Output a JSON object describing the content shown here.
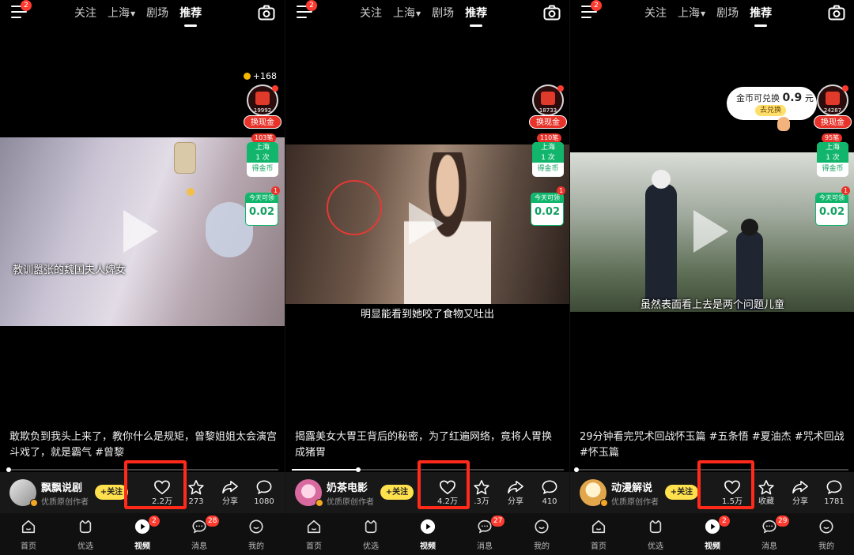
{
  "panels": [
    {
      "nav": {
        "menu_badge": "2",
        "tabs": [
          "关注",
          "上海",
          "剧场",
          "推荐"
        ],
        "active_tab": "推荐"
      },
      "coins": {
        "plus": "+168",
        "redpack_count": "19992",
        "cash_label": "换现金"
      },
      "task": {
        "badge": "103笔",
        "line1": "上海",
        "line2": "1 次",
        "line3": "得金币"
      },
      "daily": {
        "title": "今天可领",
        "amount": "0.02",
        "unit": "元",
        "badge": "1"
      },
      "video": {
        "subtitle": "教训嚣张的魏国夫人婢女",
        "progress": 0.01
      },
      "caption": "敢欺负到我头上来了，教你什么是规矩，曾黎姐姐太会演宫斗戏了，就是霸气 #曾黎",
      "author": {
        "name": "飘飘说剧",
        "tag": "优质原创作者",
        "follow": "+关注"
      },
      "actions": {
        "like": "2.2万",
        "fav": "273",
        "share": "分享",
        "comment": "1080"
      },
      "bottom_nav": [
        {
          "label": "首页",
          "badge": ""
        },
        {
          "label": "优选",
          "badge": ""
        },
        {
          "label": "视频",
          "badge": "2"
        },
        {
          "label": "消息",
          "badge": "28"
        },
        {
          "label": "我的",
          "badge": ""
        }
      ]
    },
    {
      "nav": {
        "menu_badge": "2",
        "tabs": [
          "关注",
          "上海",
          "剧场",
          "推荐"
        ],
        "active_tab": "推荐"
      },
      "coins": {
        "plus": "",
        "redpack_count": "18733",
        "cash_label": "换现金"
      },
      "task": {
        "badge": "110笔",
        "line1": "上海",
        "line2": "1 次",
        "line3": "得金币"
      },
      "daily": {
        "title": "今天可领",
        "amount": "0.02",
        "unit": "元",
        "badge": "1"
      },
      "video": {
        "subtitle": "明显能看到她咬了食物又吐出",
        "progress": 0.245
      },
      "caption": "揭露美女大胃王背后的秘密，为了红遍网络，竟将人胃换成猪胃",
      "author": {
        "name": "奶茶电影",
        "tag": "优质原创作者",
        "follow": "+关注"
      },
      "actions": {
        "like": "4.2万",
        "fav": ".3万",
        "share": "分享",
        "comment": "410"
      },
      "bottom_nav": [
        {
          "label": "首页",
          "badge": ""
        },
        {
          "label": "优选",
          "badge": ""
        },
        {
          "label": "视频",
          "badge": ""
        },
        {
          "label": "消息",
          "badge": "27"
        },
        {
          "label": "我的",
          "badge": ""
        }
      ]
    },
    {
      "nav": {
        "menu_badge": "2",
        "tabs": [
          "关注",
          "上海",
          "剧场",
          "推荐"
        ],
        "active_tab": "推荐"
      },
      "coins": {
        "plus": "",
        "redpack_count": "24287",
        "cash_label": "换现金"
      },
      "exchange": {
        "text": "金币可兑换",
        "amount": "0.9",
        "unit": "元",
        "button": "去兑换"
      },
      "task": {
        "badge": "95笔",
        "line1": "上海",
        "line2": "1 次",
        "line3": "得金币"
      },
      "daily": {
        "title": "今天可领",
        "amount": "0.02",
        "unit": "元",
        "badge": "1"
      },
      "video": {
        "subtitle": "虽然表面看上去是两个问题儿童",
        "progress": 0.0
      },
      "caption": "29分钟看完咒术回战怀玉篇 #五条悟 #夏油杰 #咒术回战#怀玉篇",
      "author": {
        "name": "动漫解说",
        "tag": "优质原创作者",
        "follow": "+关注"
      },
      "actions": {
        "like": "1.5万",
        "fav": "收藏",
        "share": "分享",
        "comment": "1781"
      },
      "bottom_nav": [
        {
          "label": "首页",
          "badge": ""
        },
        {
          "label": "优选",
          "badge": ""
        },
        {
          "label": "视频",
          "badge": "2"
        },
        {
          "label": "消息",
          "badge": "29"
        },
        {
          "label": "我的",
          "badge": ""
        }
      ]
    }
  ],
  "colors": {
    "highlight": "#ff2a1a",
    "follow": "#ffe14d",
    "task_green": "#11b56b",
    "cash_red": "#e8332a"
  }
}
